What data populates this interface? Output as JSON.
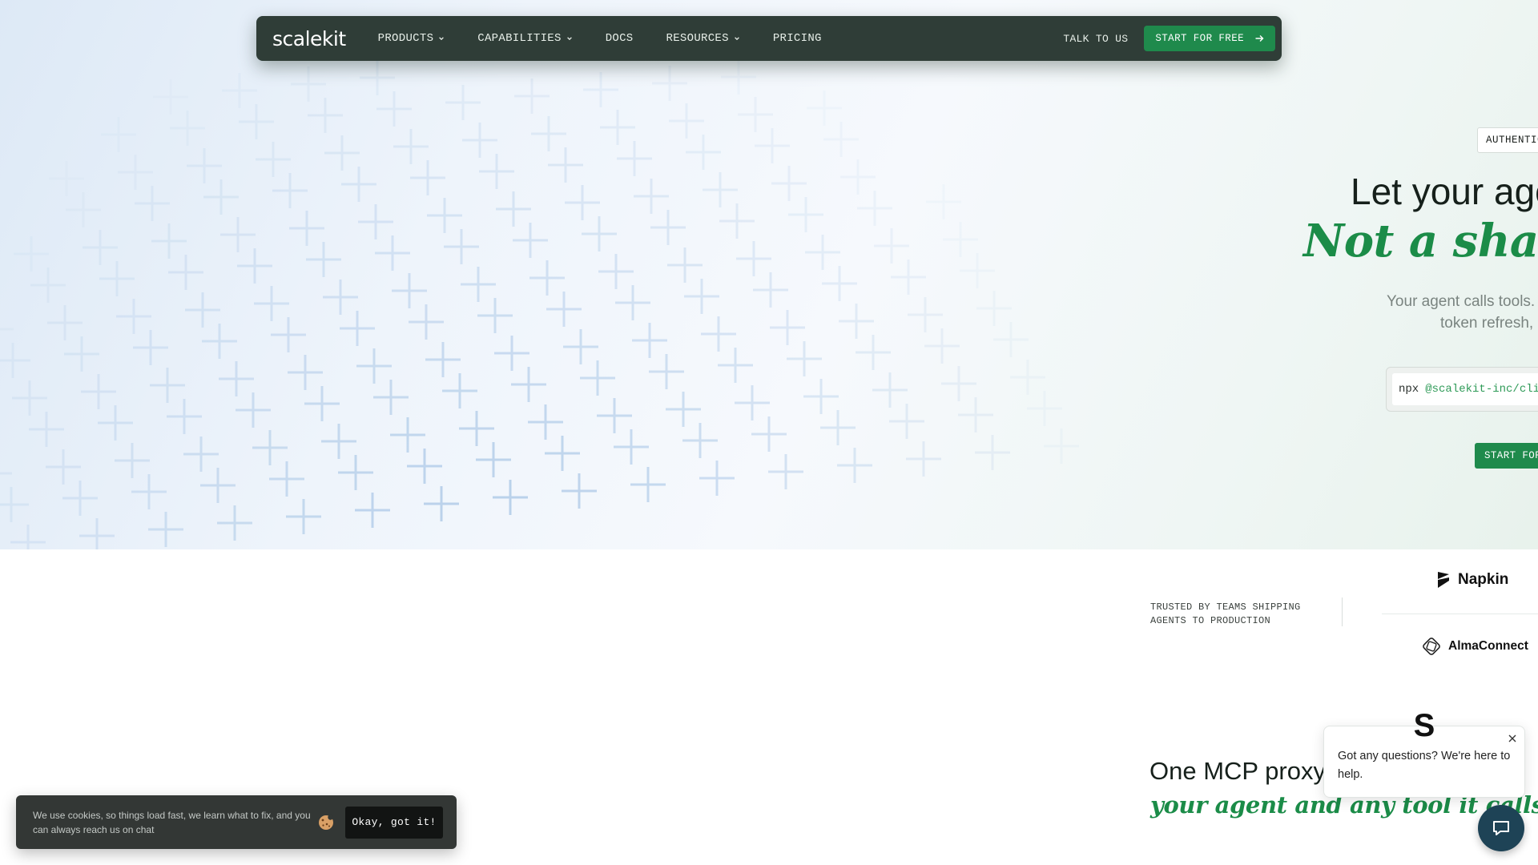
{
  "nav": {
    "logo": "scalekit",
    "items": [
      {
        "label": "PRODUCTS",
        "dropdown": true
      },
      {
        "label": "CAPABILITIES",
        "dropdown": true
      },
      {
        "label": "DOCS",
        "dropdown": false
      },
      {
        "label": "RESOURCES",
        "dropdown": true
      },
      {
        "label": "PRICING",
        "dropdown": false
      }
    ],
    "talk_label": "TALK TO US",
    "cta_label": "START FOR FREE",
    "cta_icon": "arrow-right-icon"
  },
  "hero": {
    "badge": "AUTHENTIC",
    "headline_line1": "Let your age",
    "headline_line2": "Not a share",
    "subtext_line1": "Your agent calls tools. (",
    "subtext_line2": "token refresh, a",
    "cli_command": "npx",
    "cli_package": "@scalekit-inc/cli",
    "cta_label": "START FOR"
  },
  "trusted": {
    "label": "TRUSTED BY TEAMS SHIPPING AGENTS TO PRODUCTION",
    "logos": [
      {
        "name": "Napkin",
        "icon": "napkin-logo-icon"
      },
      {
        "name": "AlmaConnect",
        "icon": "almaconnect-logo-icon"
      }
    ]
  },
  "section": {
    "heading_line1": "One MCP proxy",
    "heading_line2": "your agent and any tool it calls."
  },
  "cookie": {
    "text": "We use cookies, so things load fast, we learn what to fix, and you can always reach us on chat",
    "icon": "cookie-icon",
    "button_label": "Okay, got it!"
  },
  "chat": {
    "avatar_letter": "S",
    "message": "Got any questions? We're here to help.",
    "close_icon": "close-icon",
    "launcher_icon": "chat-bubble-icon"
  },
  "colors": {
    "nav_bg": "#2f3d37",
    "brand_green": "#1f8a4c",
    "accent_green_text": "#1b8c48",
    "chat_launcher": "#1e4356",
    "cookie_bg": "#333735"
  }
}
